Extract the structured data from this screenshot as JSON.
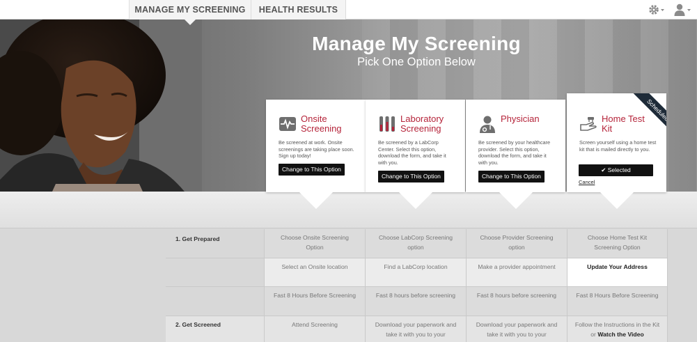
{
  "nav": {
    "tabs": [
      {
        "label": "MANAGE MY SCREENING"
      },
      {
        "label": "HEALTH RESULTS"
      }
    ],
    "icons": [
      "gear-icon",
      "user-icon"
    ]
  },
  "hero": {
    "title": "Manage My Screening",
    "subtitle": "Pick One Option Below"
  },
  "cards": [
    {
      "title_line1": "Onsite",
      "title_line2": "Screening",
      "description": "Be screened at work. Onsite screenings are taking place soon. Sign up today!",
      "button": "Change to This Option",
      "icon": "heartbeat-icon"
    },
    {
      "title_line1": "Laboratory",
      "title_line2": "Screening",
      "description": "Be screened by a LabCorp Center. Select this option, download the form, and take it with you.",
      "button": "Change to This Option",
      "icon": "test-tubes-icon"
    },
    {
      "title_line1": "Physician",
      "title_line2": "",
      "description": "Be screened by your healthcare provider. Select this option, download the form, and take it with you.",
      "button": "Change to This Option",
      "icon": "doctor-icon"
    },
    {
      "title_line1": "Home Test",
      "title_line2": "Kit",
      "description": "Screen yourself using a home test kit that is mailed directly to you.",
      "button": "Selected",
      "cancel": "Cancel",
      "ribbon": "Scheduled",
      "icon": "home-kit-hand-icon"
    }
  ],
  "steps": [
    {
      "label": "1. Get Prepared",
      "cells": [
        "Choose Onsite Screening Option",
        "Choose LabCorp Screening option",
        "Choose Provider Screening option",
        "Choose Home Test Kit Screening Option"
      ]
    },
    {
      "label": "",
      "cells": [
        "Select an Onsite location",
        "Find a LabCorp location",
        "Make a provider appointment",
        "Update Your Address"
      ]
    },
    {
      "label": "",
      "cells": [
        "Fast 8 Hours Before Screening",
        "Fast 8 hours before screening",
        "Fast 8 hours before screening",
        "Fast 8 Hours Before Screening"
      ]
    },
    {
      "label": "2. Get Screened",
      "cells": [
        "Attend Screening",
        "Download your paperwork and take it with you to your",
        "Download your paperwork and take it with you to your",
        "Follow the Instructions in the Kit or"
      ],
      "cell4_link": "Watch the Video"
    }
  ],
  "colors": {
    "accent": "#b5243a",
    "ribbon": "#1e2b38",
    "button": "#111111"
  }
}
